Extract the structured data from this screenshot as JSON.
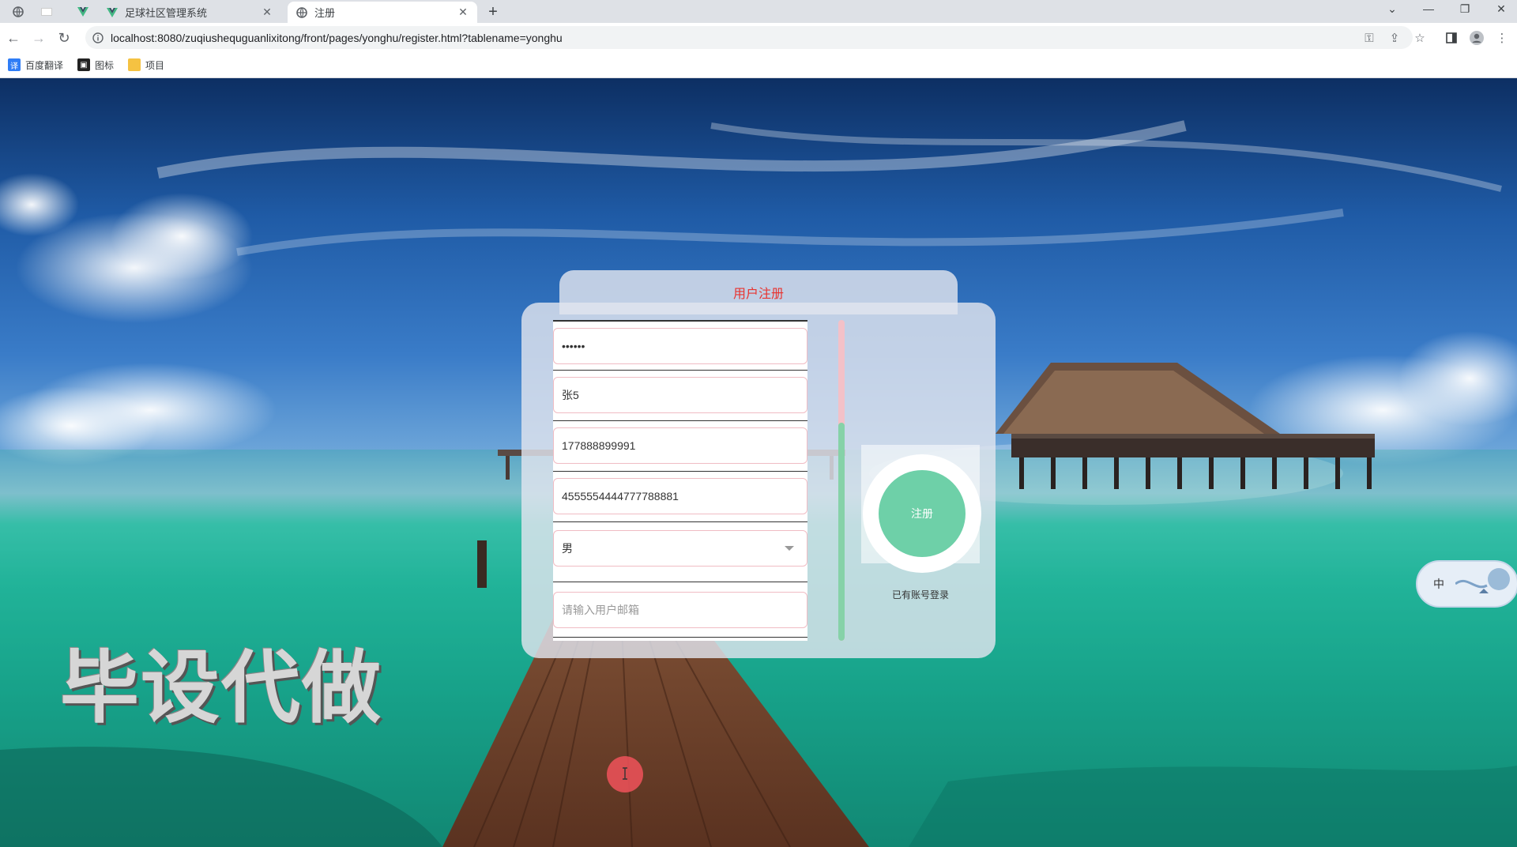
{
  "browser": {
    "tabs": [
      {
        "title": "足球社区管理系统",
        "active": false
      },
      {
        "title": "注册",
        "active": true
      }
    ],
    "url": "localhost:8080/zuqiushequguanlixitong/front/pages/yonghu/register.html?tablename=yonghu",
    "bookmarks": [
      {
        "label": "百度翻译",
        "icon": "translate-icon",
        "color": "#2f7df6"
      },
      {
        "label": "图标",
        "icon": "image-icon",
        "color": "#222222"
      },
      {
        "label": "项目",
        "icon": "folder-icon",
        "color": "#f5c242"
      }
    ]
  },
  "form": {
    "title": "用户注册",
    "fields": [
      {
        "name": "password",
        "value": "••••••"
      },
      {
        "name": "name",
        "value": "张5"
      },
      {
        "name": "phone",
        "value": "177888899991"
      },
      {
        "name": "idcard",
        "value": "4555554444777788881"
      },
      {
        "name": "gender",
        "value": "男"
      },
      {
        "name": "email",
        "value": "",
        "placeholder": "请输入用户邮箱"
      }
    ],
    "register_label": "注册",
    "login_link": "已有账号登录"
  },
  "watermark": "毕设代做",
  "ime": {
    "label": "中"
  },
  "colors": {
    "title_red": "#e8332f",
    "button_green": "#6ed0a8",
    "field_border_pink": "#f0bcc4"
  }
}
